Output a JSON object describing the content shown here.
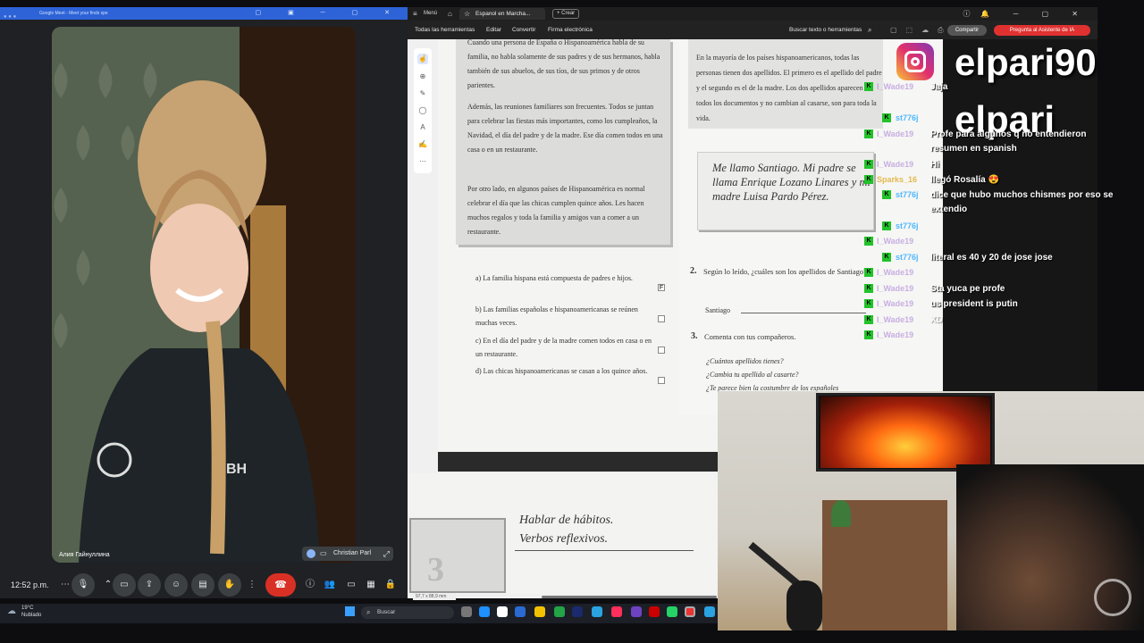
{
  "meet": {
    "window_title": "Google Meet - Meet your finds spe",
    "participant_name": "Алия Гайнуллина",
    "pip_name": "Christian Parl",
    "time": "12:52 p.m."
  },
  "acrobat": {
    "menu_label": "Menú",
    "tab_title": "Espanol en Marcha...",
    "new_tab_label": "Crear",
    "menu_items": [
      "Todas las herramientas",
      "Editar",
      "Convertir",
      "Firma electrónica"
    ],
    "search_label": "Buscar texto o herramientas",
    "share_label": "Compartir",
    "ai_label": "Pregunta al Asistente de IA",
    "status_size": "97,7 x 88,9 mm"
  },
  "book": {
    "p1": "Cuando una persona de España o Hispanoamérica habla de su familia, no habla solamente de sus padres y de sus hermanos, habla también de sus abuelos, de sus tíos, de sus primos y de otros parientes.",
    "p2": "Además, las reuniones familiares son frecuentes. Todos se juntan para celebrar las fiestas más importantes, como los cumpleaños, la Navidad, el día del padre y de la madre. Ese día comen todos en una casa o en un restaurante.",
    "p3": "Por otro lado, en algunos países de Hispanoamérica es normal celebrar el día que las chicas cumplen quince años. Les hacen muchos regalos y toda la familia y amigos van a comer a un restaurante.",
    "items": [
      {
        "label": "a) La familia hispana está compuesta de padres e hijos.",
        "mark": "F"
      },
      {
        "label": "b) Las familias españolas e hispanoamericanas se reúnen muchas veces.",
        "mark": ""
      },
      {
        "label": "c) En el día del padre y de la madre comen todos en casa o en un restaurante.",
        "mark": ""
      },
      {
        "label": "d) Las chicas hispanoamericanas se casan a los quince años.",
        "mark": ""
      }
    ],
    "right_p": "En la mayoría de los países hispanoamericanos, todas las personas tienen dos apellidos. El primero es el apellido del padre y el segundo es el de la madre. Los dos apellidos aparecen en todos los documentos y no cambian al casarse, son para toda la vida.",
    "handwritten": "Me llamo Santiago. Mi padre se llama Enrique Lozano Linares y mi madre Luisa Pardo Pérez.",
    "q2_num": "2.",
    "q2": "Según lo leído, ¿cuáles son los apellidos de Santiago?",
    "q2_answer": "Santiago",
    "q3_num": "3.",
    "q3": "Comenta con tus compañeros.",
    "q3_lines": [
      "¿Cuántos apellidos tienes?",
      "¿Cambia tu apellido al casarte?",
      "¿Te parece bien la costumbre de los españoles"
    ],
    "page2_title1": "Hablar de hábitos.",
    "page2_title2": "Verbos reflexivos.",
    "page2_num": "3"
  },
  "overlay": {
    "insta_handle": "elpari90",
    "handle2": "elpari",
    "chat": [
      {
        "user": "I_Wade19",
        "msg": "Jaja"
      },
      {
        "user": "st776j",
        "msg": ""
      },
      {
        "user": "I_Wade19",
        "msg": "Profe para algunos q no entendieron resumen en spanish"
      },
      {
        "user": "I_Wade19",
        "msg": "Hi"
      },
      {
        "user": "Sparks_16",
        "msg": "llegó Rosalía 😍"
      },
      {
        "user": "st776j",
        "msg": "dice que hubo muchos chismes por eso se extendio"
      },
      {
        "user": "st776j",
        "msg": ""
      },
      {
        "user": "I_Wade19",
        "msg": ""
      },
      {
        "user": "st776j",
        "msg": "literal es 40 y 20 de jose jose"
      },
      {
        "user": "I_Wade19",
        "msg": ""
      },
      {
        "user": "I_Wade19",
        "msg": "Sta yuca pe profe"
      },
      {
        "user": "I_Wade19",
        "msg": "us president is putin"
      },
      {
        "user": "I_Wade19",
        "msg": "XD"
      },
      {
        "user": "I_Wade19",
        "msg": ""
      }
    ]
  },
  "taskbar": {
    "weather_temp": "19°C",
    "weather_desc": "Nublado",
    "search": "Buscar"
  }
}
